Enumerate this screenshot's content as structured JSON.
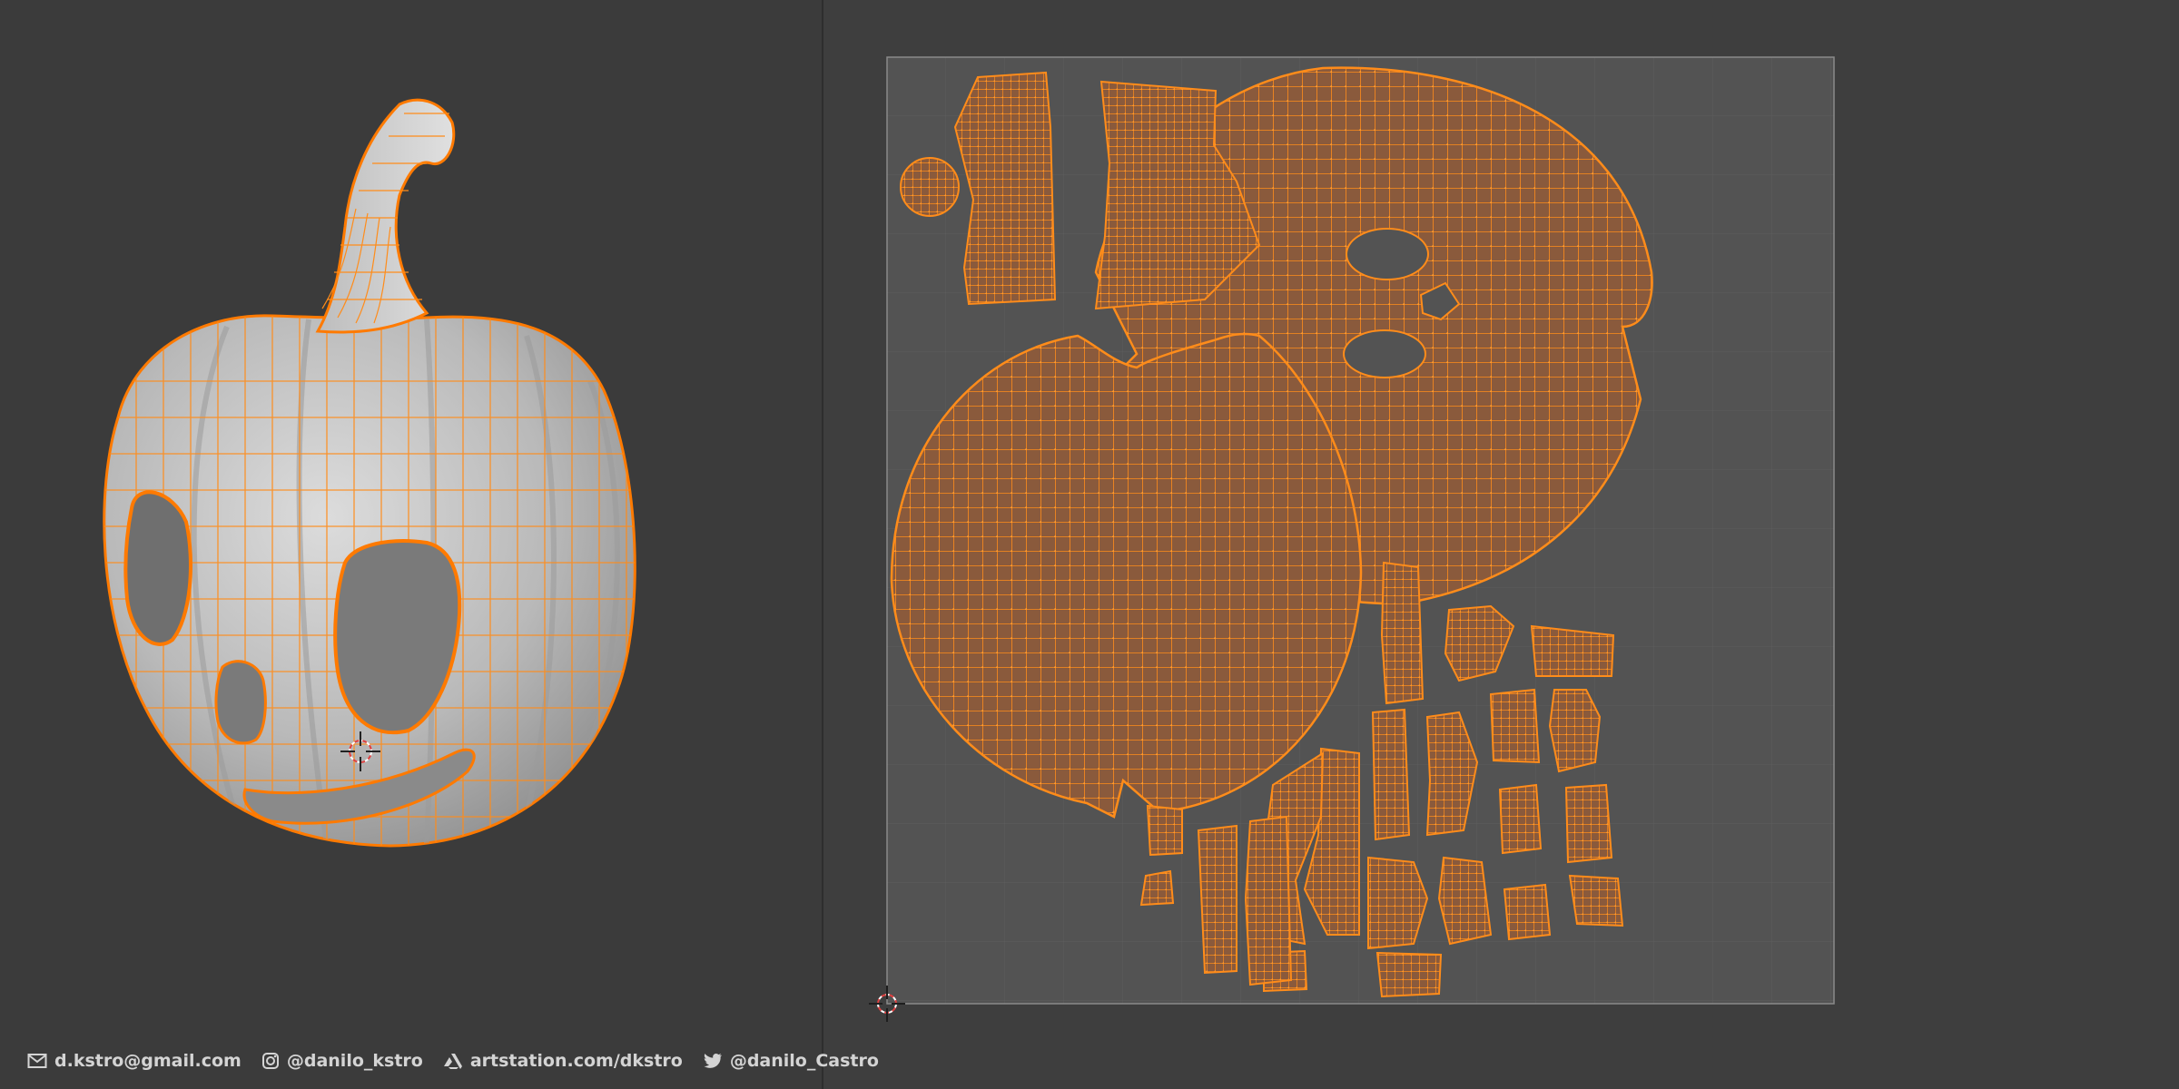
{
  "contacts": {
    "email": "d.kstro@gmail.com",
    "instagram": "@danilo_kstro",
    "artstation": "artstation.com/dkstro",
    "twitter": "@danilo_Castro"
  },
  "icons": {
    "email": "envelope-icon",
    "instagram": "instagram-icon",
    "artstation": "artstation-icon",
    "twitter": "twitter-icon",
    "cursor": "3d-cursor-icon",
    "uv_cursor": "2d-cursor-icon"
  },
  "colors": {
    "viewport_bg": "#3b3b3b",
    "uv_bg": "#3e3e3e",
    "uv_grid_area": "#535353",
    "mesh_surface": "#c9c9c9",
    "wire_orange": "#ff8c1a",
    "uv_island_fill": "#8a5a3c",
    "text": "#d4d4d4"
  }
}
